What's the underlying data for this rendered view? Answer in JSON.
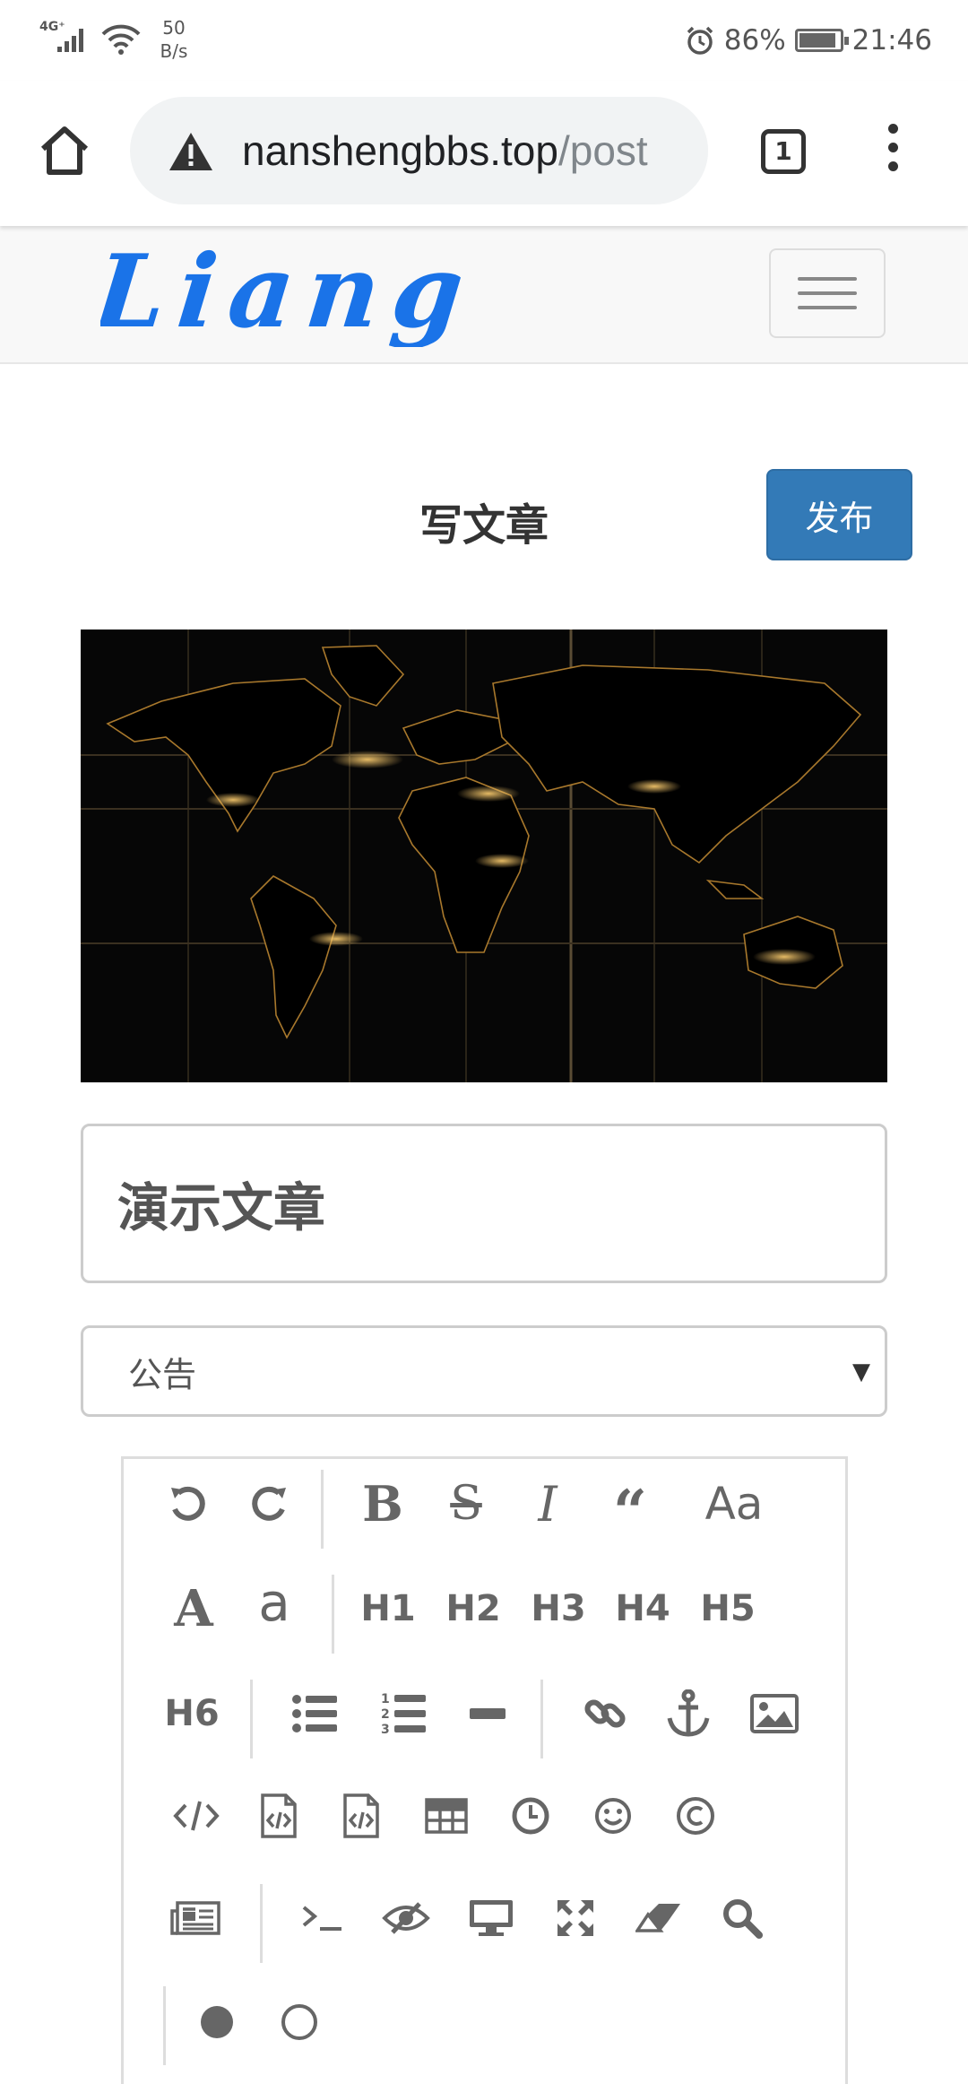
{
  "status_bar": {
    "network_type": "4G⁺",
    "net_speed_value": "50",
    "net_speed_unit": "B/s",
    "battery": "86%",
    "time": "21:46"
  },
  "browser": {
    "url_host": "nanshengbbs.top",
    "url_path": "/post",
    "tab_count": "1"
  },
  "site": {
    "logo_text": "Liang"
  },
  "editor": {
    "page_title": "写文章",
    "publish_label": "发布",
    "article_title": "演示文章",
    "category_selected": "公告"
  },
  "toolbar": {
    "undo": "undo-icon",
    "redo": "redo-icon",
    "headings": [
      "H1",
      "H2",
      "H3",
      "H4",
      "H5",
      "H6"
    ],
    "case_label": "Aa",
    "uppercase_label": "A",
    "lowercase_label": "a"
  },
  "colors": {
    "accent": "#337ab7",
    "logo_blue": "#1a73e8",
    "icon_gray": "#666666"
  }
}
